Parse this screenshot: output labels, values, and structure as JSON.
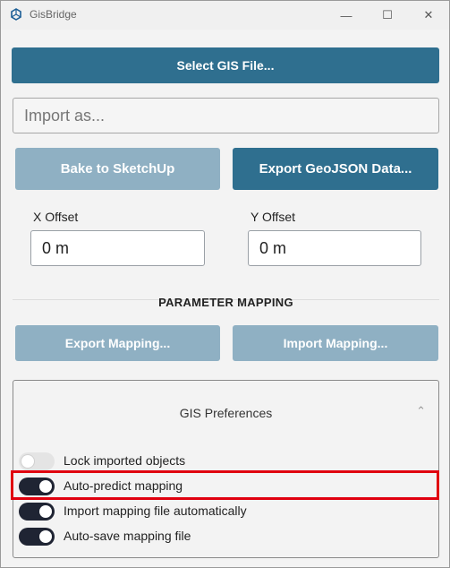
{
  "window": {
    "title": "GisBridge",
    "controls": {
      "minimize": "—",
      "maximize": "☐",
      "close": "✕"
    }
  },
  "actions": {
    "select_file": "Select GIS File...",
    "import_as_placeholder": "Import as...",
    "bake": "Bake to SketchUp",
    "export_geojson": "Export GeoJSON Data..."
  },
  "offsets": {
    "x_label": "X Offset",
    "x_value": "0 m",
    "y_label": "Y Offset",
    "y_value": "0 m"
  },
  "mapping": {
    "section_title": "PARAMETER MAPPING",
    "export_label": "Export Mapping...",
    "import_label": "Import Mapping..."
  },
  "preferences": {
    "title": "GIS Preferences",
    "chevron": "⌃",
    "toggles": [
      {
        "label": "Lock imported objects",
        "on": false
      },
      {
        "label": "Auto-predict mapping",
        "on": true
      },
      {
        "label": "Import mapping file automatically",
        "on": true
      },
      {
        "label": "Auto-save mapping file",
        "on": true
      }
    ]
  },
  "colors": {
    "primary": "#2f6f8f",
    "disabled": "#8fb0c3",
    "toggle_on": "#1f2433",
    "highlight": "#e0000f"
  }
}
